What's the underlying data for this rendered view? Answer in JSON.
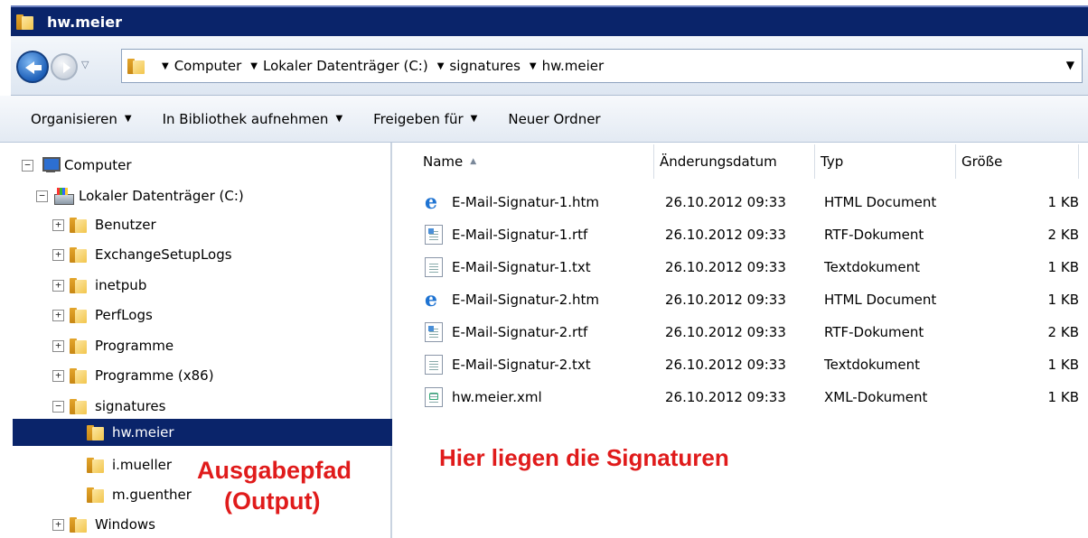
{
  "window": {
    "title": "hw.meier"
  },
  "address": {
    "crumbs": [
      "Computer",
      "Lokaler Datenträger (C:)",
      "signatures",
      "hw.meier"
    ]
  },
  "toolbar": {
    "organize": "Organisieren",
    "library": "In Bibliothek aufnehmen",
    "share": "Freigeben für",
    "new_folder": "Neuer Ordner"
  },
  "tree": {
    "computer": "Computer",
    "drive": "Lokaler Datenträger (C:)",
    "folders": [
      "Benutzer",
      "ExchangeSetupLogs",
      "inetpub",
      "PerfLogs",
      "Programme",
      "Programme (x86)",
      "signatures"
    ],
    "signatures_children": [
      "hw.meier",
      "i.mueller",
      "m.guenther"
    ],
    "windows": "Windows"
  },
  "annotations": {
    "output_line1": "Ausgabepfad",
    "output_line2": "(Output)",
    "signatures_here": "Hier liegen die Signaturen"
  },
  "columns": {
    "name": "Name",
    "date": "Änderungsdatum",
    "type": "Typ",
    "size": "Größe"
  },
  "files": [
    {
      "name": "E-Mail-Signatur-1.htm",
      "date": "26.10.2012 09:33",
      "type": "HTML Document",
      "size": "1 KB",
      "icon": "ie-icon"
    },
    {
      "name": "E-Mail-Signatur-1.rtf",
      "date": "26.10.2012 09:33",
      "type": "RTF-Dokument",
      "size": "2 KB",
      "icon": "rtf-icon"
    },
    {
      "name": "E-Mail-Signatur-1.txt",
      "date": "26.10.2012 09:33",
      "type": "Textdokument",
      "size": "1 KB",
      "icon": "txt-icon"
    },
    {
      "name": "E-Mail-Signatur-2.htm",
      "date": "26.10.2012 09:33",
      "type": "HTML Document",
      "size": "1 KB",
      "icon": "ie-icon"
    },
    {
      "name": "E-Mail-Signatur-2.rtf",
      "date": "26.10.2012 09:33",
      "type": "RTF-Dokument",
      "size": "2 KB",
      "icon": "rtf-icon"
    },
    {
      "name": "E-Mail-Signatur-2.txt",
      "date": "26.10.2012 09:33",
      "type": "Textdokument",
      "size": "1 KB",
      "icon": "txt-icon"
    },
    {
      "name": "hw.meier.xml",
      "date": "26.10.2012 09:33",
      "type": "XML-Dokument",
      "size": "1 KB",
      "icon": "xml-icon"
    }
  ]
}
